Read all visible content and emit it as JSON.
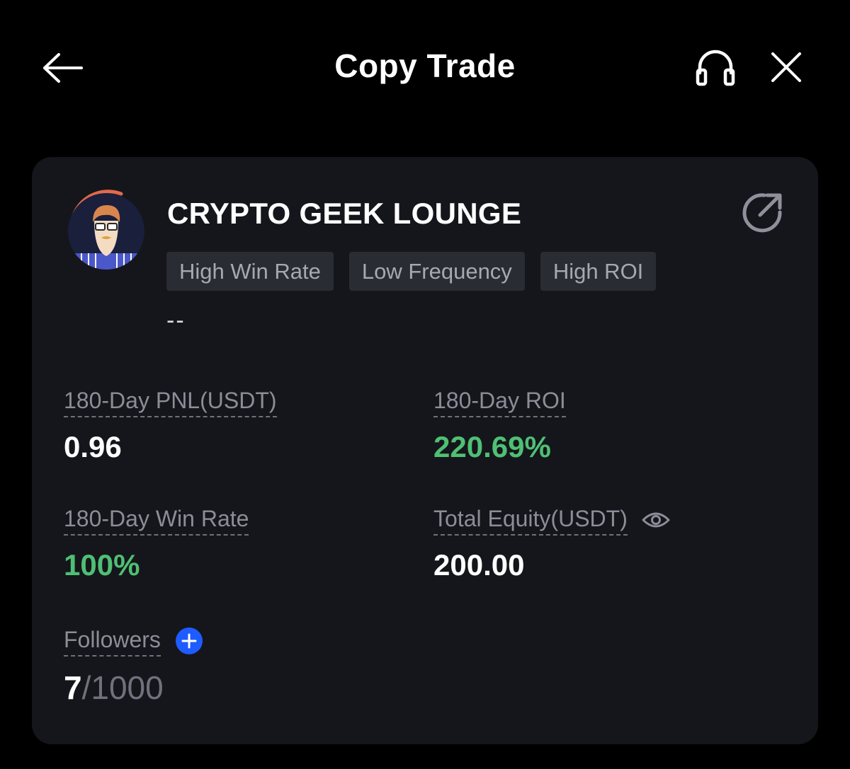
{
  "header": {
    "title": "Copy Trade",
    "back_icon": "arrow-left-icon",
    "support_icon": "headphones-icon",
    "close_icon": "close-icon"
  },
  "trader": {
    "name": "CRYPTO GEEK LOUNGE",
    "avatar_icon": "avatar-cartoon-man",
    "share_icon": "share-icon",
    "tags": [
      "High Win Rate",
      "Low Frequency",
      "High ROI"
    ],
    "bio": "--"
  },
  "stats": {
    "pnl": {
      "label": "180-Day PNL(USDT)",
      "value": "0.96"
    },
    "roi": {
      "label": "180-Day ROI",
      "value": "220.69%"
    },
    "win_rate": {
      "label": "180-Day Win Rate",
      "value": "100%"
    },
    "equity": {
      "label": "Total Equity(USDT)",
      "value": "200.00",
      "visibility_icon": "eye-icon"
    },
    "followers": {
      "label": "Followers",
      "current": "7",
      "separator": "/",
      "max": "1000",
      "add_icon": "plus-circle-icon"
    }
  },
  "colors": {
    "background": "#000000",
    "card": "#15161b",
    "positive": "#4fbf74",
    "accent_blue": "#1f5cff",
    "muted_text": "#8b8e98",
    "tag_bg": "#2a2c33"
  }
}
